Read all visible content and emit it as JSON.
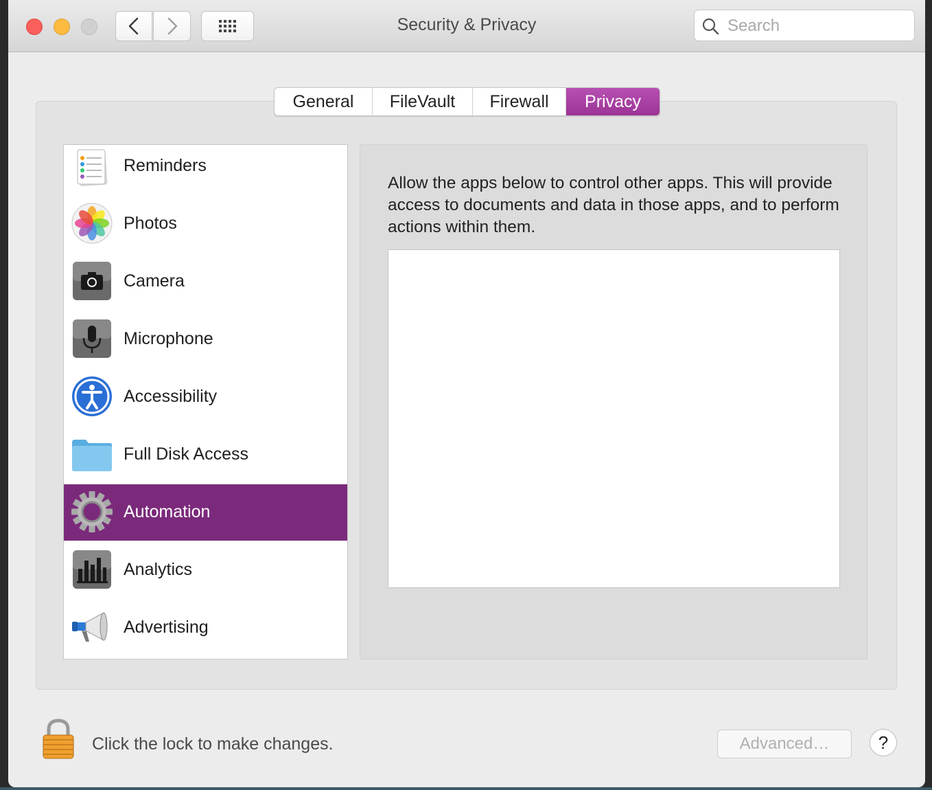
{
  "window": {
    "title": "Security & Privacy"
  },
  "search": {
    "placeholder": "Search"
  },
  "tabs": [
    {
      "label": "General",
      "active": false
    },
    {
      "label": "FileVault",
      "active": false
    },
    {
      "label": "Firewall",
      "active": false
    },
    {
      "label": "Privacy",
      "active": true
    }
  ],
  "sidebar": {
    "items": [
      {
        "label": "Reminders",
        "icon": "reminders-icon"
      },
      {
        "label": "Photos",
        "icon": "photos-icon"
      },
      {
        "label": "Camera",
        "icon": "camera-icon"
      },
      {
        "label": "Microphone",
        "icon": "microphone-icon"
      },
      {
        "label": "Accessibility",
        "icon": "accessibility-icon"
      },
      {
        "label": "Full Disk Access",
        "icon": "folder-icon"
      },
      {
        "label": "Automation",
        "icon": "gear-icon",
        "selected": true
      },
      {
        "label": "Analytics",
        "icon": "analytics-icon"
      },
      {
        "label": "Advertising",
        "icon": "megaphone-icon"
      }
    ]
  },
  "detail": {
    "description": "Allow the apps below to control other apps. This will provide access to documents and data in those apps, and to perform actions within them."
  },
  "footer": {
    "lock_text": "Click the lock to make changes.",
    "advanced_label": "Advanced…",
    "help_label": "?"
  },
  "colors": {
    "accent": "#9b3495",
    "selection": "#7b2a7b"
  }
}
